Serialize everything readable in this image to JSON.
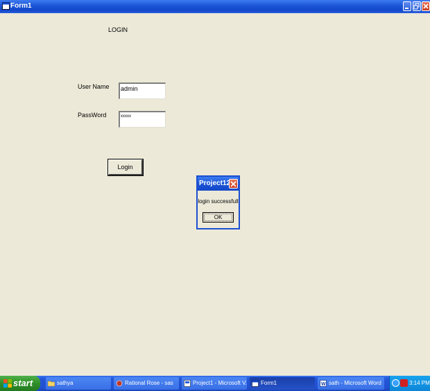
{
  "window": {
    "title": "Form1"
  },
  "form": {
    "heading": "LOGIN",
    "username_label": "User Name",
    "username_value": "admin",
    "password_label": "PassWord",
    "password_value": "xxxxx",
    "login_button": "Login"
  },
  "dialog": {
    "title": "Project12",
    "message": "login successfull",
    "ok_button": "OK"
  },
  "taskbar": {
    "start_label": "start",
    "tasks": [
      {
        "label": "sathya",
        "icon": "folder-icon"
      },
      {
        "label": "Rational Rose - sas",
        "icon": "rose-icon"
      },
      {
        "label": "Project1 - Microsoft V...",
        "icon": "vb-icon"
      },
      {
        "label": "Form1",
        "icon": "form-icon"
      },
      {
        "label": "sath - Microsoft Word",
        "icon": "word-icon"
      }
    ],
    "clock": "3:14 PM"
  }
}
